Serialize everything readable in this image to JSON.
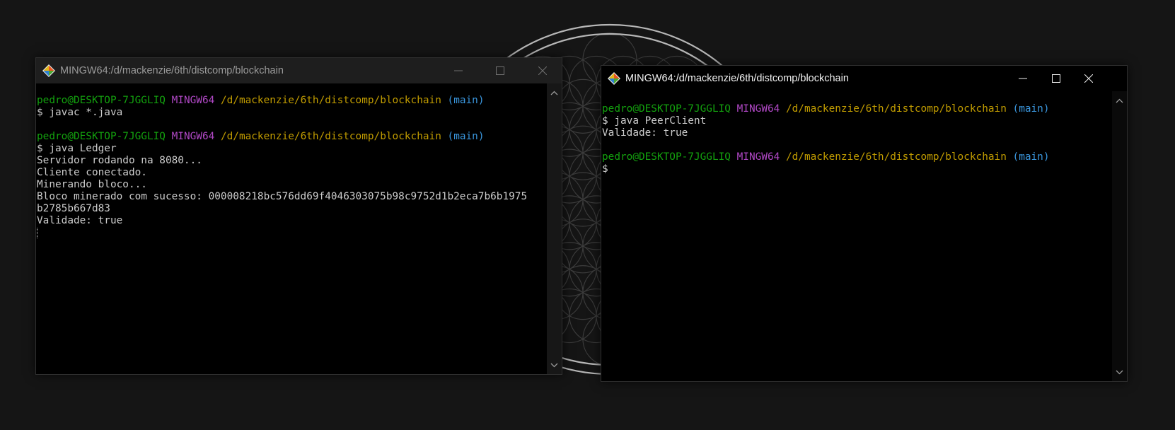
{
  "windows": [
    {
      "title": "MINGW64:/d/mackenzie/6th/distcomp/blockchain",
      "lines": [
        {
          "type": "prompt",
          "user": "pedro@DESKTOP-7JGGLIQ",
          "shell": "MINGW64",
          "path": "/d/mackenzie/6th/distcomp/blockchain",
          "branch": "(main)"
        },
        {
          "type": "text",
          "text": "$ javac *.java"
        },
        {
          "type": "blank",
          "text": ""
        },
        {
          "type": "prompt",
          "user": "pedro@DESKTOP-7JGGLIQ",
          "shell": "MINGW64",
          "path": "/d/mackenzie/6th/distcomp/blockchain",
          "branch": "(main)"
        },
        {
          "type": "text",
          "text": "$ java Ledger"
        },
        {
          "type": "text",
          "text": "Servidor rodando na 8080..."
        },
        {
          "type": "text",
          "text": "Cliente conectado."
        },
        {
          "type": "text",
          "text": "Minerando bloco..."
        },
        {
          "type": "text",
          "text": "Bloco minerado com sucesso: 000008218bc576dd69f4046303075b98c9752d1b2eca7b6b1975"
        },
        {
          "type": "text",
          "text": "b2785b667d83"
        },
        {
          "type": "text",
          "text": "Validade: true"
        },
        {
          "type": "cursor",
          "text": ""
        }
      ]
    },
    {
      "title": "MINGW64:/d/mackenzie/6th/distcomp/blockchain",
      "lines": [
        {
          "type": "prompt",
          "user": "pedro@DESKTOP-7JGGLIQ",
          "shell": "MINGW64",
          "path": "/d/mackenzie/6th/distcomp/blockchain",
          "branch": "(main)"
        },
        {
          "type": "text",
          "text": "$ java PeerClient"
        },
        {
          "type": "text",
          "text": "Validade: true"
        },
        {
          "type": "blank",
          "text": ""
        },
        {
          "type": "prompt",
          "user": "pedro@DESKTOP-7JGGLIQ",
          "shell": "MINGW64",
          "path": "/d/mackenzie/6th/distcomp/blockchain",
          "branch": "(main)"
        },
        {
          "type": "text",
          "text": "$"
        }
      ]
    }
  ],
  "icons": {
    "app": "git-bash-icon",
    "minimize": "minimize-icon",
    "maximize": "maximize-icon",
    "close": "close-icon",
    "scroll_up": "chevron-up-icon",
    "scroll_down": "chevron-down-icon"
  },
  "colors": {
    "desktop_bg": "#151515",
    "terminal_bg": "#000000",
    "text": "#cccccc",
    "user": "#13a10e",
    "shell": "#b148c6",
    "path": "#c19c00",
    "branch": "#3a96dd",
    "wallpaper_lines": "#5c5c5c"
  }
}
